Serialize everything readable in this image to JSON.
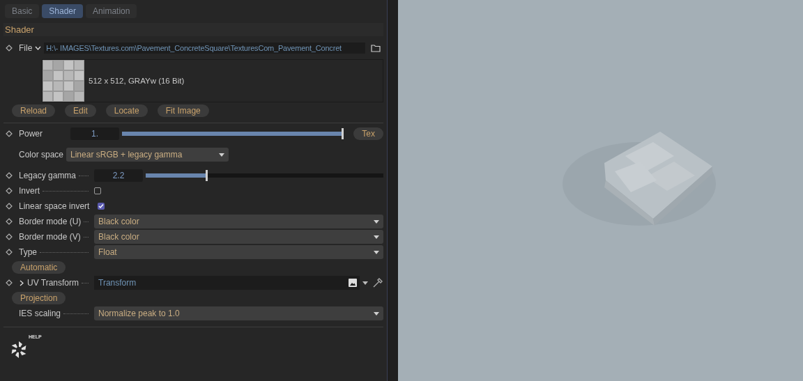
{
  "tabs": [
    {
      "label": "Basic",
      "selected": false
    },
    {
      "label": "Shader",
      "selected": true
    },
    {
      "label": "Animation",
      "selected": false
    }
  ],
  "section_title": "Shader",
  "file": {
    "label": "File",
    "expanded": true,
    "path": "H:\\- IMAGES\\Textures.com\\Pavement_ConcreteSquare\\TexturesCom_Pavement_Concret",
    "info": "512 x 512, GRAYw (16 Bit)",
    "buttons": [
      "Reload",
      "Edit",
      "Locate",
      "Fit Image"
    ]
  },
  "params": [
    {
      "kind": "slider",
      "label": "Power",
      "keyable": true,
      "value": "1.",
      "level": 1,
      "button": "Tex"
    },
    {
      "kind": "dropdown",
      "label": "Color space",
      "keyable": false,
      "compact": true,
      "value": "Linear sRGB + legacy gamma"
    },
    {
      "kind": "slider",
      "label": "Legacy gamma",
      "keyable": true,
      "value": "2.2",
      "level": 0.26
    },
    {
      "kind": "checkbox",
      "label": "Invert",
      "keyable": true,
      "checked": false
    },
    {
      "kind": "checkbox",
      "label": "Linear space invert",
      "keyable": true,
      "checked": true
    },
    {
      "kind": "dropdown",
      "label": "Border mode (U)",
      "keyable": true,
      "compact": false,
      "value": "Black color"
    },
    {
      "kind": "dropdown",
      "label": "Border mode (V)",
      "keyable": true,
      "compact": false,
      "value": "Black color"
    },
    {
      "kind": "dropdown",
      "label": "Type",
      "keyable": true,
      "compact": false,
      "value": "Float"
    },
    {
      "kind": "button",
      "label": "Automatic"
    },
    {
      "kind": "link",
      "label": "UV Transform",
      "keyable": true,
      "expanded": false,
      "value": "Transform"
    },
    {
      "kind": "button",
      "label": "Projection"
    },
    {
      "kind": "dropdown",
      "label": "IES scaling",
      "keyable": false,
      "compact": false,
      "value": "Normalize peak to 1.0"
    }
  ],
  "help": {
    "label": "HELP"
  }
}
